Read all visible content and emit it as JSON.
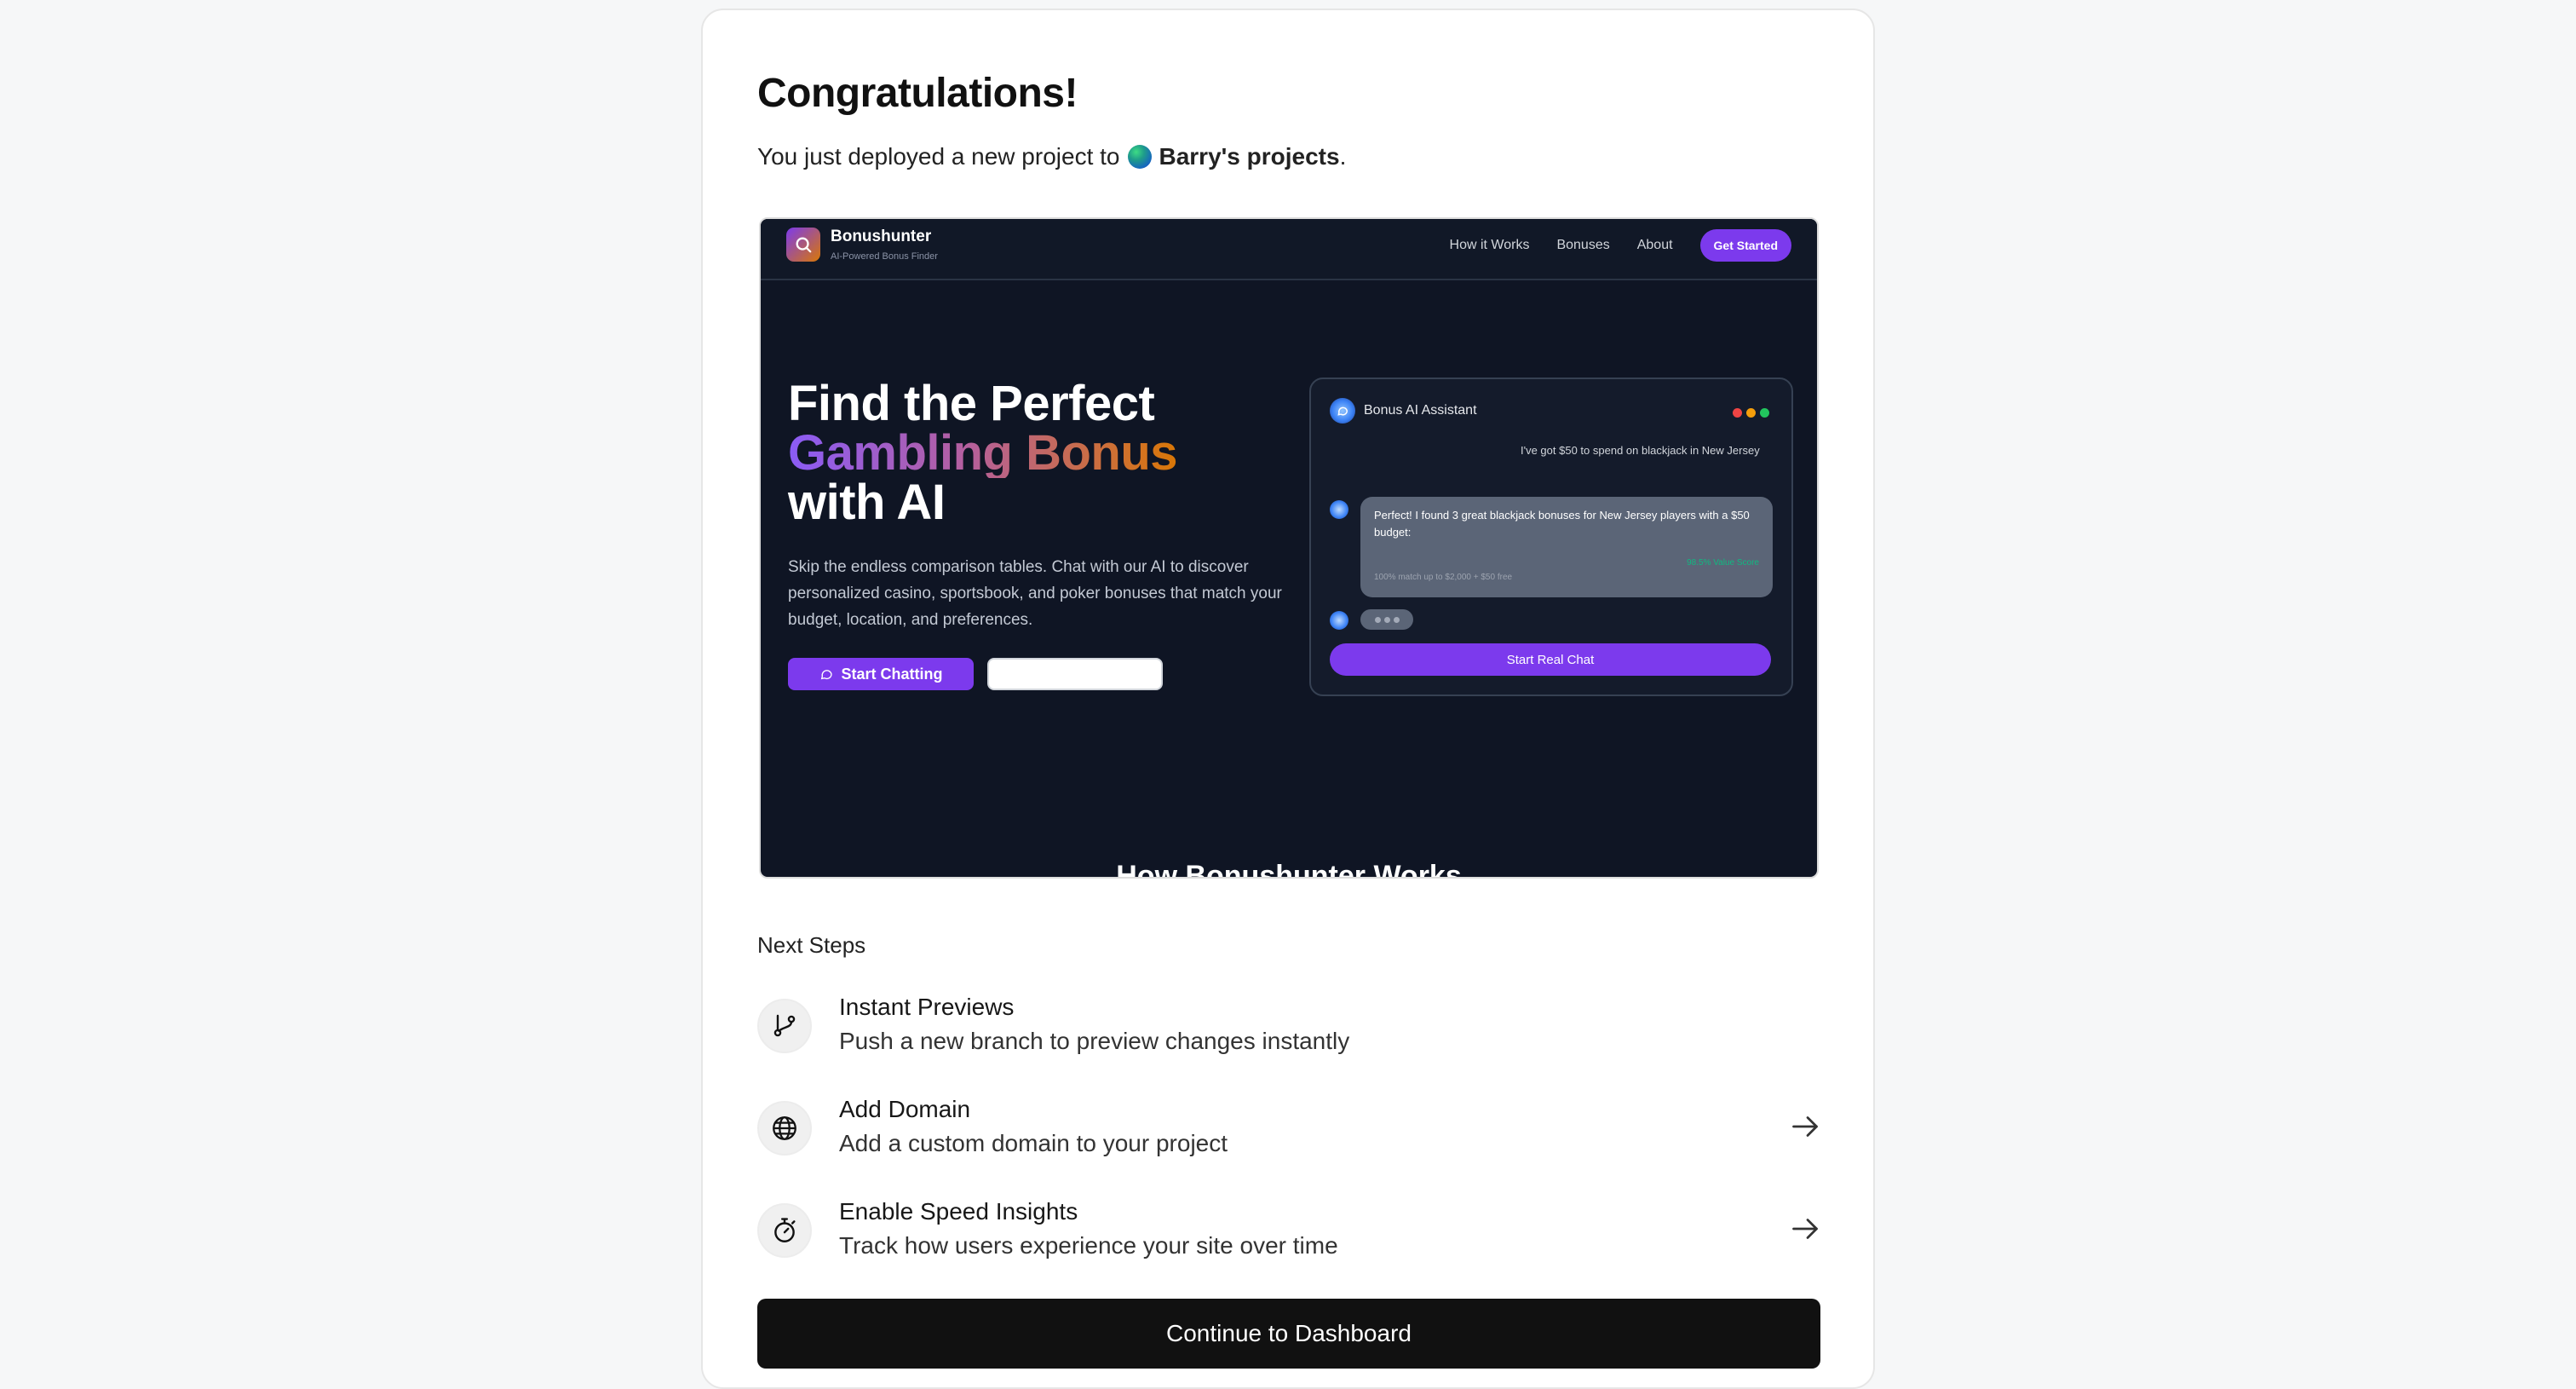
{
  "page": {
    "title": "Congratulations!",
    "subtitle_prefix": "You just deployed a new project to",
    "team_name": "Barry's projects",
    "subtitle_suffix": "."
  },
  "preview": {
    "brand": "Bonushunter",
    "tagline": "AI-Powered Bonus Finder",
    "nav_links": [
      "How it Works",
      "Bonuses",
      "About"
    ],
    "nav_cta": "Get Started",
    "headline_1": "Find the Perfect",
    "headline_2": "Gambling Bonus",
    "headline_3": "with AI",
    "body": "Skip the endless comparison tables. Chat with our AI to discover personalized casino, sportsbook, and poker bonuses that match your budget, location, and preferences.",
    "primary_button": "Start Chatting",
    "chat_title": "Bonus AI Assistant",
    "user_message": "I've got $50 to spend on blackjack in New Jersey",
    "bot_message": "Perfect! I found 3 great blackjack bonuses for New Jersey players with a $50 budget:",
    "bonus_name": "",
    "bonus_score": "98.5% Value Score",
    "bonus_detail": "100% match up to $2,000 + $50 free",
    "chat_button": "Start Real Chat",
    "section_heading": "How Bonushunter Works",
    "colors": {
      "accent": "#7c3aed",
      "background": "#0f1524"
    }
  },
  "next_steps": {
    "label": "Next Steps",
    "items": [
      {
        "title": "Instant Previews",
        "description": "Push a new branch to preview changes instantly",
        "icon": "git-branch-icon"
      },
      {
        "title": "Add Domain",
        "description": "Add a custom domain to your project",
        "icon": "globe-icon"
      },
      {
        "title": "Enable Speed Insights",
        "description": "Track how users experience your site over time",
        "icon": "stopwatch-icon"
      }
    ]
  },
  "continue_button": "Continue to Dashboard"
}
